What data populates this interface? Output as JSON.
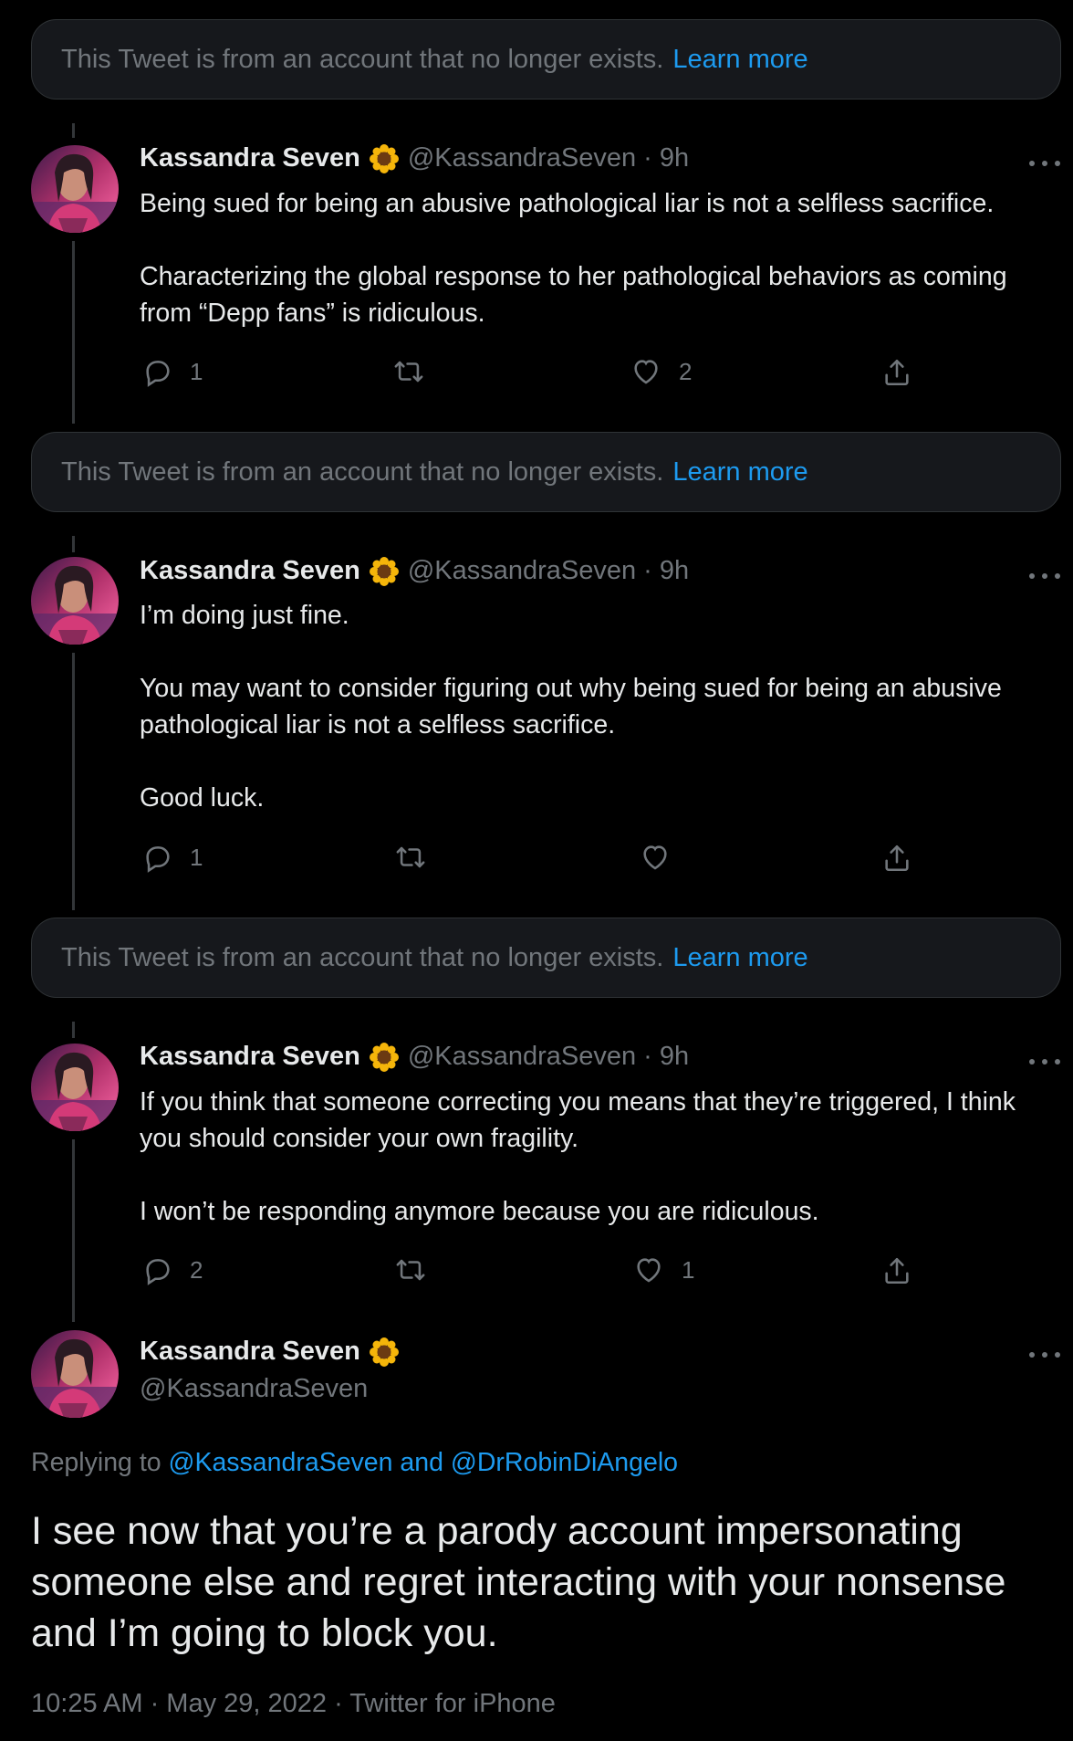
{
  "tombstone": {
    "text": "This Tweet is from an account that no longer exists.",
    "link": "Learn more"
  },
  "author": {
    "name": "Kassandra Seven",
    "badge_icon": "sunflower-icon",
    "handle": "@KassandraSeven"
  },
  "tweets": [
    {
      "meta": "@KassandraSeven · 9h",
      "paragraphs": [
        "Being sued for being an abusive pathological liar is not a selfless sacrifice.",
        "Characterizing the global response to her pathological behaviors as coming from “Depp fans” is ridiculous."
      ],
      "reply_count": "1",
      "retweet_count": "",
      "like_count": "2"
    },
    {
      "meta": "@KassandraSeven · 9h",
      "paragraphs": [
        "I’m doing just fine.",
        "You may want to consider figuring out why being sued for being an abusive pathological liar is not a selfless sacrifice.",
        "Good luck."
      ],
      "reply_count": "1",
      "retweet_count": "",
      "like_count": ""
    },
    {
      "meta": "@KassandraSeven · 9h",
      "paragraphs": [
        "If you think that someone correcting you means that they’re triggered, I think you should consider your own fragility.",
        "I won’t be responding anymore because you are ridiculous."
      ],
      "reply_count": "2",
      "retweet_count": "",
      "like_count": "1"
    }
  ],
  "main_tweet": {
    "replying_prefix": "Replying to",
    "replying_targets": "@KassandraSeven and @DrRobinDiAngelo",
    "text": "I see now that you’re a parody account impersonating someone else and regret interacting with your nonsense and I’m going to block you.",
    "meta": "10:25 AM · May 29, 2022 · Twitter for iPhone"
  },
  "colors": {
    "background": "#000000",
    "text": "#e7e9ea",
    "secondary": "#71767b",
    "link": "#1d9bf0",
    "tombstone_bg": "#16181c"
  }
}
